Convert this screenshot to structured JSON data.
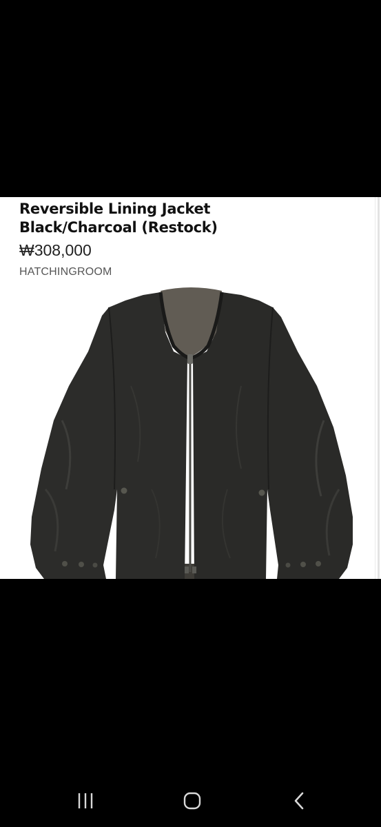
{
  "product": {
    "title_line1": "Reversible Lining Jacket",
    "title_line2": "Black/Charcoal (Restock)",
    "price": "₩308,000",
    "brand": "HATCHINGROOM"
  },
  "image": {
    "subject": "jacket-photo",
    "colors": {
      "shell": "#2a2a28",
      "lining": "#5f5a52",
      "background": "#ffffff"
    }
  },
  "navigation_bar": {
    "recent_icon": "recent-apps-icon",
    "home_icon": "home-icon",
    "back_icon": "back-icon",
    "icon_color": "#d8d8d8"
  }
}
